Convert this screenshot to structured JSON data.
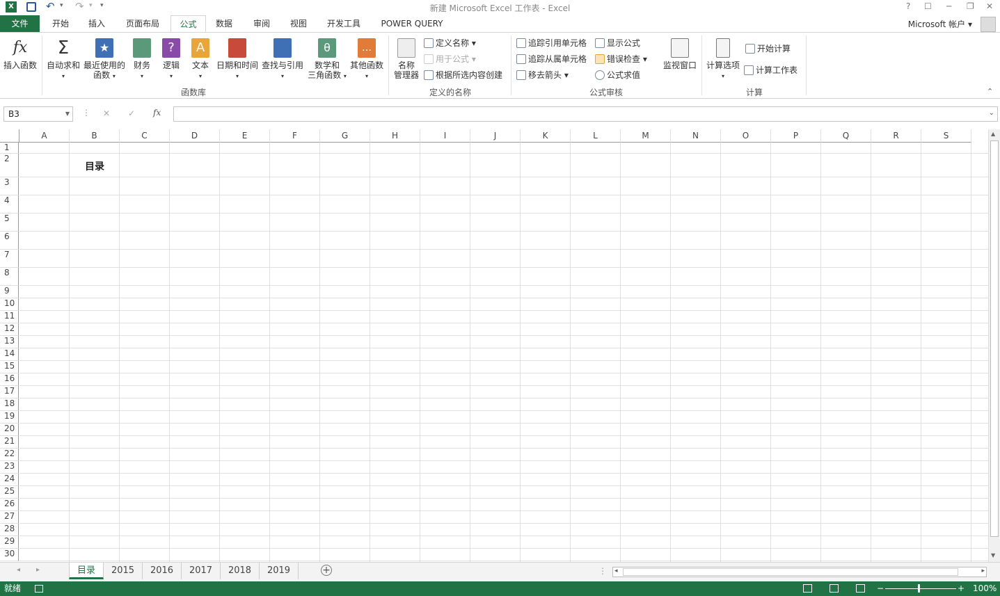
{
  "title": "新建 Microsoft Excel 工作表 - Excel",
  "window_controls": [
    "?",
    "☐",
    "─",
    "❐",
    "✕"
  ],
  "quick_access": {
    "excel_icon": "excel-logo",
    "save": "save-icon",
    "undo": "undo-icon",
    "redo": "redo-icon"
  },
  "tabs": {
    "file": "文件",
    "home": "开始",
    "insert": "插入",
    "layout": "页面布局",
    "formulas": "公式",
    "data": "数据",
    "review": "审阅",
    "view": "视图",
    "developer": "开发工具",
    "powerquery": "POWER QUERY"
  },
  "account": "Microsoft 帐户",
  "ribbon": {
    "insert_function": "插入函数",
    "autosum": "自动求和",
    "recent_1": "最近使用的",
    "recent_2": "函数",
    "financial": "财务",
    "logical": "逻辑",
    "text": "文本",
    "datetime": "日期和时间",
    "lookup": "查找与引用",
    "math_1": "数学和",
    "math_2": "三角函数",
    "more": "其他函数",
    "group_library": "函数库",
    "name_mgr_1": "名称",
    "name_mgr_2": "管理器",
    "define_name": "定义名称",
    "use_in_formula": "用于公式",
    "create_from_sel": "根据所选内容创建",
    "group_names": "定义的名称",
    "trace_precedents": "追踪引用单元格",
    "trace_dependents": "追踪从属单元格",
    "remove_arrows": "移去箭头",
    "show_formulas": "显示公式",
    "error_check": "错误检查",
    "evaluate": "公式求值",
    "watch": "监视窗口",
    "group_audit": "公式审核",
    "calc_options": "计算选项",
    "calc_now": "开始计算",
    "calc_sheet": "计算工作表",
    "group_calc": "计算"
  },
  "formula_bar": {
    "name_box": "B3",
    "fx": "fx",
    "cancel": "✕",
    "enter": "✓",
    "value": ""
  },
  "columns": [
    "A",
    "B",
    "C",
    "D",
    "E",
    "F",
    "G",
    "H",
    "I",
    "J",
    "K",
    "L",
    "M",
    "N",
    "O",
    "P",
    "Q",
    "R",
    "S"
  ],
  "rows": [
    "1",
    "2",
    "3",
    "4",
    "5",
    "6",
    "7",
    "8",
    "9",
    "10",
    "11",
    "12",
    "13",
    "14",
    "15",
    "16",
    "17",
    "18",
    "19",
    "20",
    "21",
    "22",
    "23",
    "24",
    "25",
    "26",
    "27",
    "28",
    "29",
    "30"
  ],
  "cells": {
    "B2": "目录"
  },
  "sheets": [
    "目录",
    "2015",
    "2016",
    "2017",
    "2018",
    "2019"
  ],
  "active_sheet": "目录",
  "status": {
    "ready": "就绪",
    "zoom": "100%"
  },
  "accent_color": "#217346"
}
